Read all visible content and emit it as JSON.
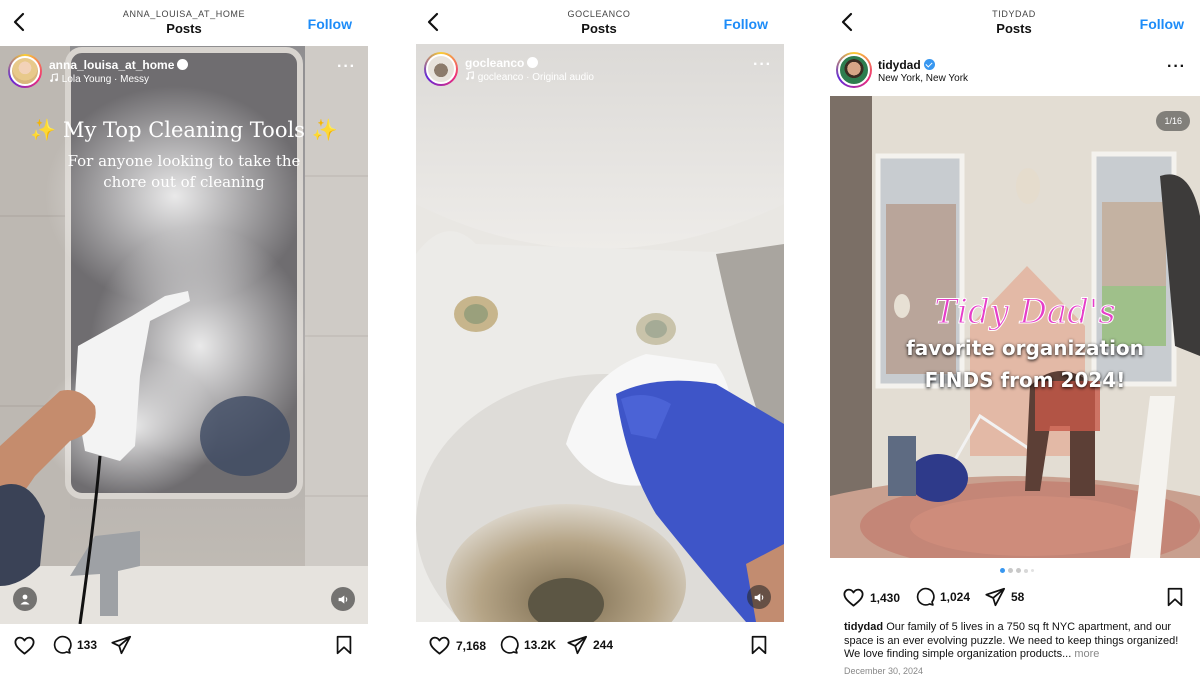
{
  "colors": {
    "follow": "#1d8cf8",
    "verified": "#3897f0",
    "tidy_pink": "#e63ec9"
  },
  "posts": [
    {
      "header": {
        "handle_caps": "ANNA_LOUISA_AT_HOME",
        "title": "Posts",
        "follow": "Follow"
      },
      "user": {
        "username": "anna_louisa_at_home",
        "verified": true,
        "audio": "Lola Young · Messy"
      },
      "overlay": {
        "title": "✨ My Top Cleaning Tools ✨",
        "subtitle_line1": "For anyone looking to take the",
        "subtitle_line2": "chore out of cleaning"
      },
      "stats": {
        "comments": "133"
      }
    },
    {
      "header": {
        "handle_caps": "GOCLEANCO",
        "title": "Posts",
        "follow": "Follow"
      },
      "user": {
        "username": "gocleanco",
        "verified": true,
        "audio": "gocleanco · Original audio"
      },
      "stats": {
        "likes": "7,168",
        "comments": "13.2K",
        "shares": "244"
      }
    },
    {
      "header": {
        "handle_caps": "TIDYDAD",
        "title": "Posts",
        "follow": "Follow"
      },
      "user": {
        "username": "tidydad",
        "verified": true,
        "location": "New York, New York"
      },
      "overlay": {
        "line1": "Tidy Dad's",
        "line2": "favorite organization",
        "line3": "FINDS from 2024!"
      },
      "carousel": {
        "counter": "1/16",
        "current_index": 1,
        "total_dots": 5
      },
      "stats": {
        "likes": "1,430",
        "comments": "1,024",
        "shares": "58"
      },
      "caption": {
        "username": "tidydad",
        "text": "Our family of 5 lives in a 750 sq ft NYC apartment, and our space is an ever evolving puzzle. We need to keep things organized! We love finding simple organization products...",
        "more": "more"
      },
      "date": "December 30, 2024"
    }
  ]
}
